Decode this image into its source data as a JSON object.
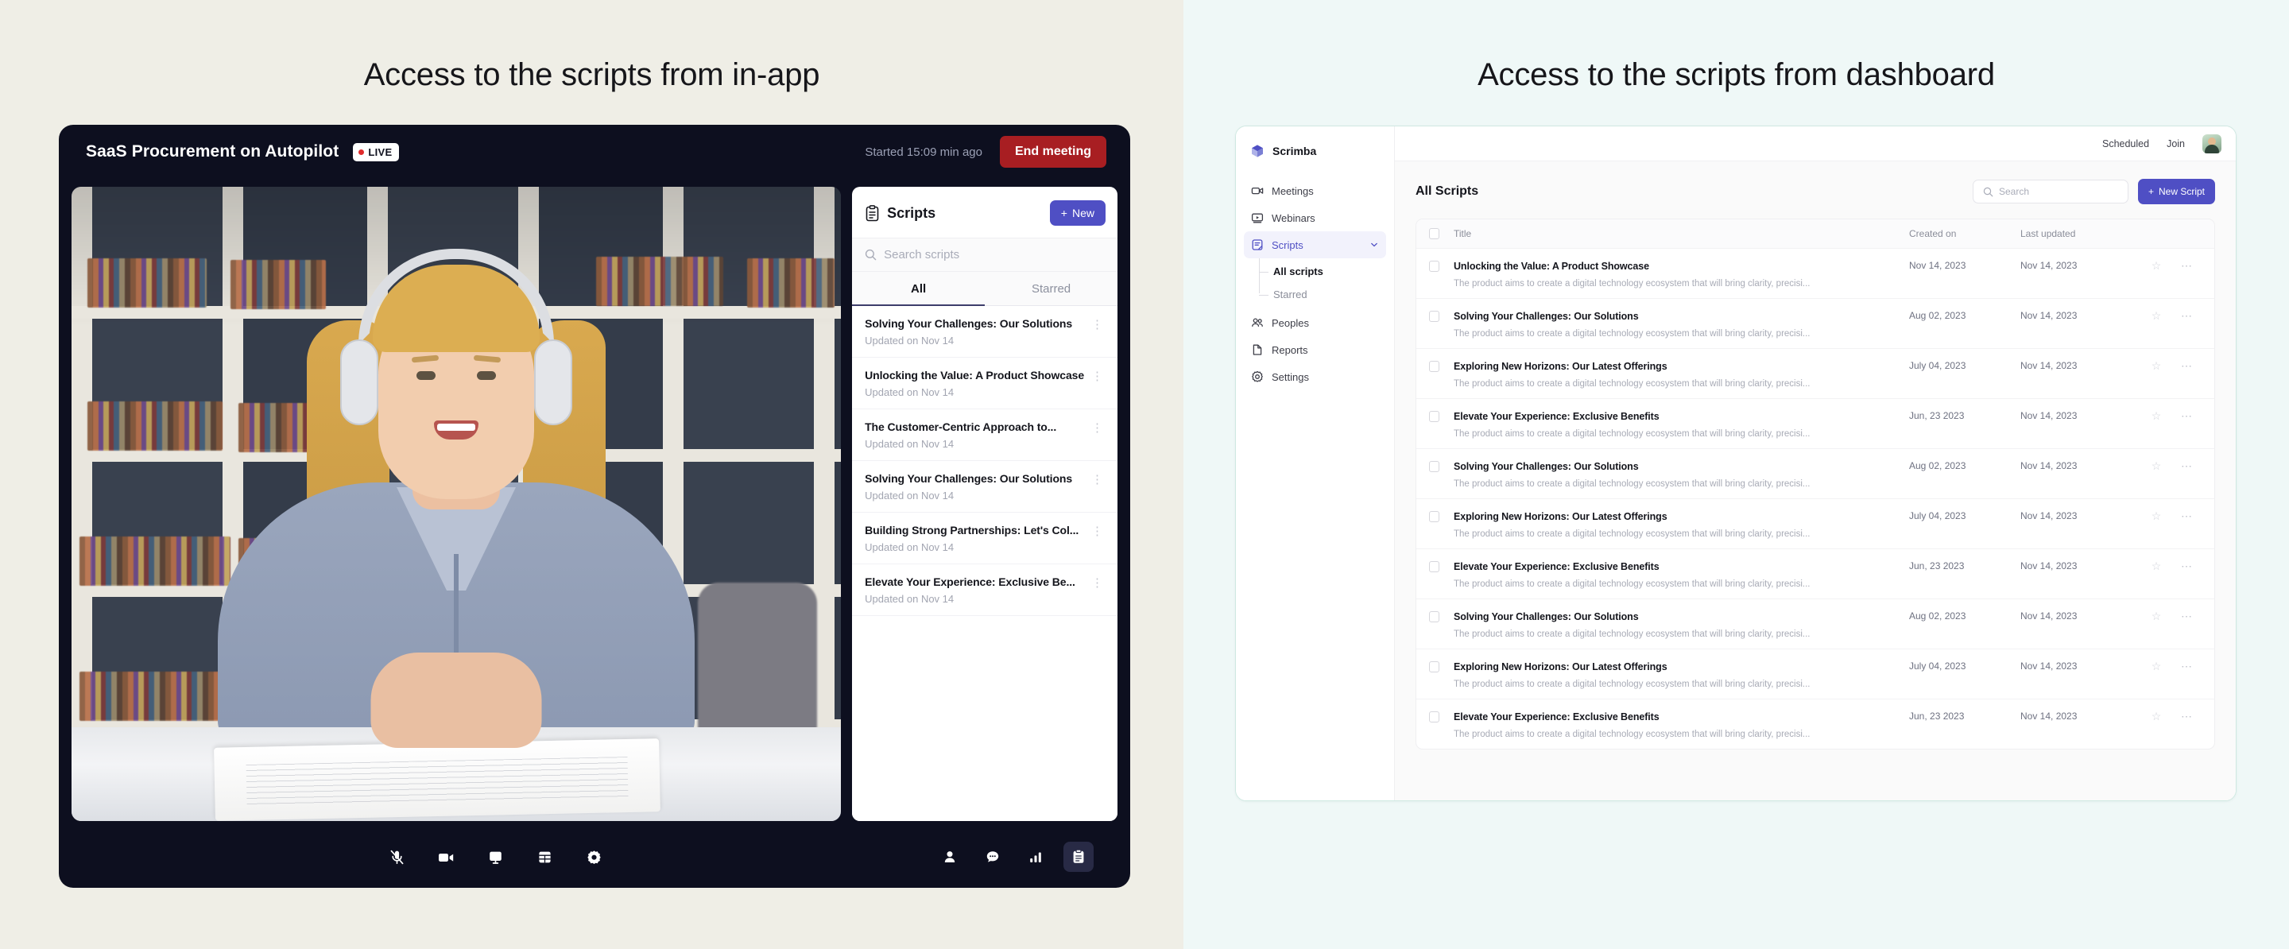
{
  "left_section": {
    "caption": "Access to the scripts from in-app",
    "background_color": "#EFEEE6",
    "meeting": {
      "title": "SaaS Procurement on Autopilot",
      "live_badge": "LIVE",
      "started_text": "Started 15:09 min ago",
      "end_button": "End meeting",
      "window_background": "#0D0F1F",
      "end_button_color": "#A81E22",
      "controls_left": [
        {
          "name": "microphone-muted-icon",
          "label": "Microphone muted",
          "active": false
        },
        {
          "name": "camera-icon",
          "label": "Camera",
          "active": false
        },
        {
          "name": "screen-share-icon",
          "label": "Share screen",
          "active": false
        },
        {
          "name": "layout-icon",
          "label": "Layout",
          "active": false
        },
        {
          "name": "settings-gear-icon",
          "label": "Settings",
          "active": false
        }
      ],
      "controls_right": [
        {
          "name": "participants-icon",
          "label": "Participants",
          "active": false
        },
        {
          "name": "chat-icon",
          "label": "Chat",
          "active": false
        },
        {
          "name": "analytics-icon",
          "label": "Analytics",
          "active": false
        },
        {
          "name": "scripts-clipboard-icon",
          "label": "Scripts",
          "active": true
        }
      ]
    },
    "scripts_panel": {
      "title": "Scripts",
      "title_icon": "clipboard-icon",
      "new_button": "New",
      "new_button_color": "#4F4FC4",
      "search_placeholder": "Search scripts",
      "search_value": "",
      "tabs": [
        {
          "label": "All",
          "active": true
        },
        {
          "label": "Starred",
          "active": false
        }
      ],
      "items": [
        {
          "title": "Solving Your Challenges: Our Solutions",
          "subtitle": "Updated on Nov 14"
        },
        {
          "title": "Unlocking the Value: A Product Showcase",
          "subtitle": "Updated on Nov 14"
        },
        {
          "title": "The Customer-Centric Approach to...",
          "subtitle": "Updated on Nov 14"
        },
        {
          "title": "Solving Your Challenges: Our Solutions",
          "subtitle": "Updated on Nov 14"
        },
        {
          "title": "Building Strong Partnerships: Let's Col...",
          "subtitle": "Updated on Nov 14"
        },
        {
          "title": "Elevate Your Experience: Exclusive Be...",
          "subtitle": "Updated on Nov 14"
        }
      ]
    }
  },
  "right_section": {
    "caption": "Access to the scripts from dashboard",
    "background_color": "#EFF8F7",
    "sidebar": {
      "brand": "Scrimba",
      "brand_icon": "cube-logo-icon",
      "items": [
        {
          "label": "Meetings",
          "icon": "video-camera-icon",
          "active": false
        },
        {
          "label": "Webinars",
          "icon": "webinar-screen-icon",
          "active": false
        },
        {
          "label": "Scripts",
          "icon": "script-document-icon",
          "active": true,
          "expanded": true,
          "chevron": "chevron-down-icon",
          "children": [
            {
              "label": "All scripts",
              "active": true
            },
            {
              "label": "Starred",
              "active": false
            }
          ]
        },
        {
          "label": "Peoples",
          "icon": "people-icon",
          "active": false
        },
        {
          "label": "Reports",
          "icon": "report-document-icon",
          "active": false
        },
        {
          "label": "Settings",
          "icon": "gear-icon",
          "active": false
        }
      ]
    },
    "topbar": {
      "scheduled_label": "Scheduled",
      "join_label": "Join",
      "avatar": "user-avatar"
    },
    "content": {
      "heading": "All Scripts",
      "search_placeholder": "Search",
      "search_value": "",
      "new_script_button": "New Script",
      "new_script_color": "#4F4FC4",
      "columns": [
        "Title",
        "Created on",
        "Last updated"
      ],
      "rows": [
        {
          "title": "Unlocking the Value: A Product Showcase",
          "description": "The product aims to create a digital technology ecosystem that will bring clarity, precisi...",
          "created": "Nov 14, 2023",
          "updated": "Nov 14, 2023",
          "starred": false
        },
        {
          "title": "Solving Your Challenges: Our Solutions",
          "description": "The product aims to create a digital technology ecosystem that will bring clarity, precisi...",
          "created": "Aug 02, 2023",
          "updated": "Nov 14, 2023",
          "starred": false
        },
        {
          "title": "Exploring New Horizons: Our Latest Offerings",
          "description": "The product aims to create a digital technology ecosystem that will bring clarity, precisi...",
          "created": "July 04, 2023",
          "updated": "Nov 14, 2023",
          "starred": false
        },
        {
          "title": "Elevate Your Experience: Exclusive Benefits",
          "description": "The product aims to create a digital technology ecosystem that will bring clarity, precisi...",
          "created": "Jun, 23 2023",
          "updated": "Nov 14, 2023",
          "starred": false
        },
        {
          "title": "Solving Your Challenges: Our Solutions",
          "description": "The product aims to create a digital technology ecosystem that will bring clarity, precisi...",
          "created": "Aug 02, 2023",
          "updated": "Nov 14, 2023",
          "starred": false
        },
        {
          "title": "Exploring New Horizons: Our Latest Offerings",
          "description": "The product aims to create a digital technology ecosystem that will bring clarity, precisi...",
          "created": "July 04, 2023",
          "updated": "Nov 14, 2023",
          "starred": false
        },
        {
          "title": "Elevate Your Experience: Exclusive Benefits",
          "description": "The product aims to create a digital technology ecosystem that will bring clarity, precisi...",
          "created": "Jun, 23 2023",
          "updated": "Nov 14, 2023",
          "starred": false
        },
        {
          "title": "Solving Your Challenges: Our Solutions",
          "description": "The product aims to create a digital technology ecosystem that will bring clarity, precisi...",
          "created": "Aug 02, 2023",
          "updated": "Nov 14, 2023",
          "starred": false
        },
        {
          "title": "Exploring New Horizons: Our Latest Offerings",
          "description": "The product aims to create a digital technology ecosystem that will bring clarity, precisi...",
          "created": "July 04, 2023",
          "updated": "Nov 14, 2023",
          "starred": false
        },
        {
          "title": "Elevate Your Experience: Exclusive Benefits",
          "description": "The product aims to create a digital technology ecosystem that will bring clarity, precisi...",
          "created": "Jun, 23 2023",
          "updated": "Nov 14, 2023",
          "starred": false
        }
      ]
    }
  }
}
